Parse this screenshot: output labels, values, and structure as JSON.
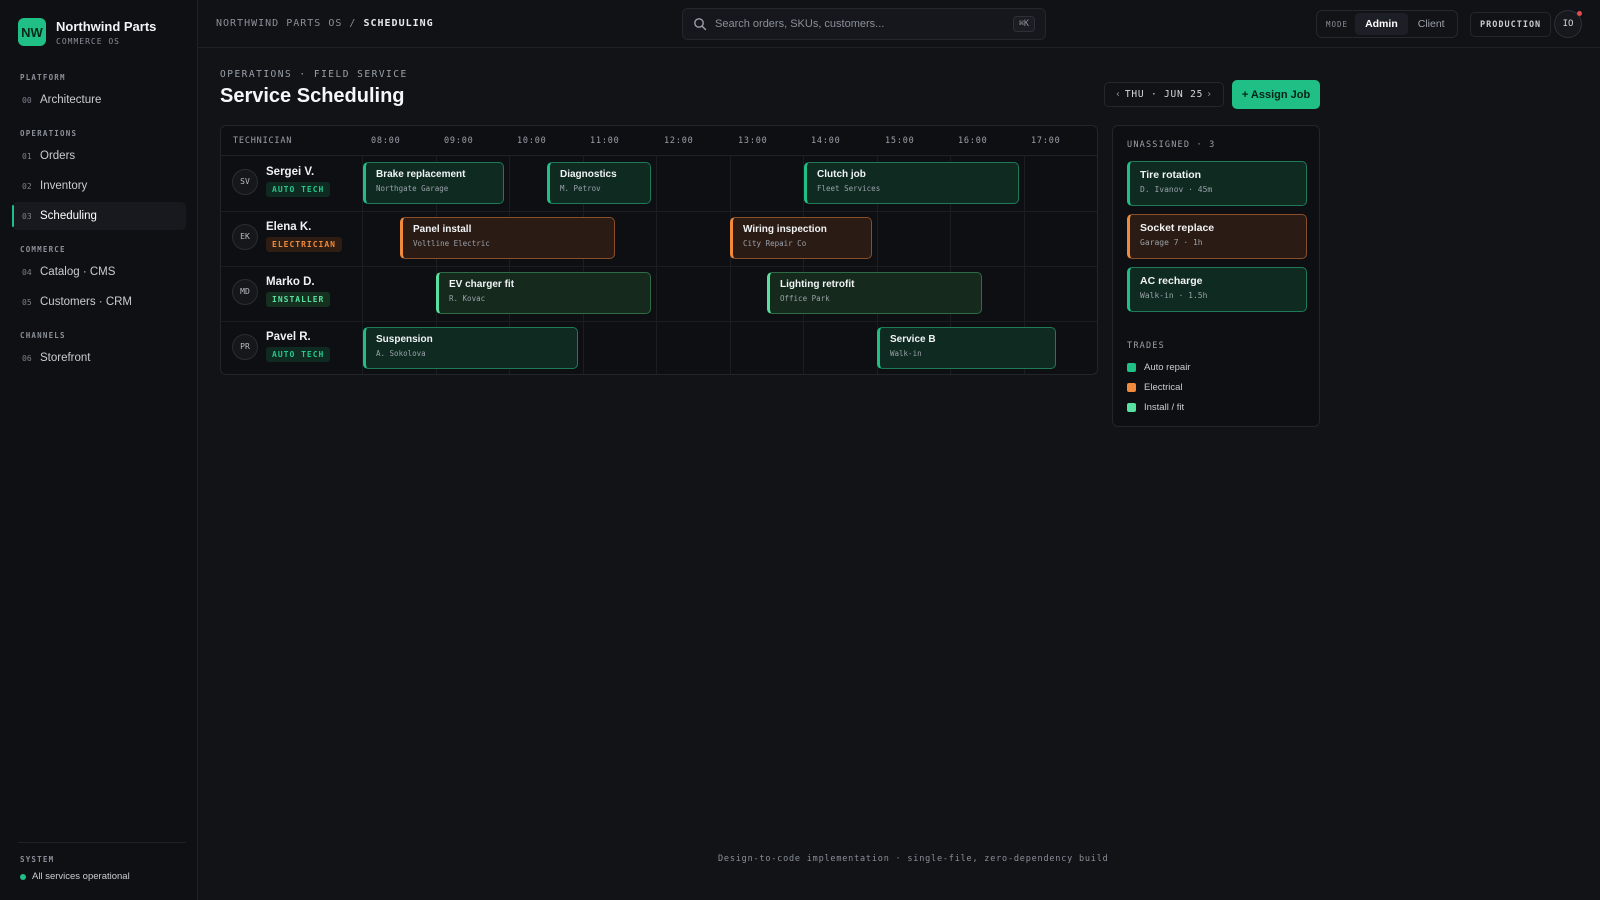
{
  "brand": {
    "logo": "NW",
    "name": "Northwind Parts",
    "subtitle": "COMMERCE OS"
  },
  "sidebar": {
    "sections": [
      {
        "label": "PLATFORM",
        "items": [
          {
            "num": "00",
            "label": "Architecture"
          }
        ]
      },
      {
        "label": "OPERATIONS",
        "items": [
          {
            "num": "01",
            "label": "Orders"
          },
          {
            "num": "02",
            "label": "Inventory"
          },
          {
            "num": "03",
            "label": "Scheduling",
            "active": true
          }
        ]
      },
      {
        "label": "COMMERCE",
        "items": [
          {
            "num": "04",
            "label": "Catalog · CMS"
          },
          {
            "num": "05",
            "label": "Customers · CRM"
          }
        ]
      },
      {
        "label": "CHANNELS",
        "items": [
          {
            "num": "06",
            "label": "Storefront"
          }
        ]
      }
    ],
    "system_label": "SYSTEM",
    "system_status": "All services operational"
  },
  "topbar": {
    "breadcrumb_root": "NORTHWIND PARTS OS",
    "breadcrumb_sep": "/",
    "breadcrumb_current": "SCHEDULING",
    "search_placeholder": "Search orders, SKUs, customers...",
    "search_shortcut": "⌘K",
    "mode_label": "MODE",
    "mode_options": [
      "Admin",
      "Client"
    ],
    "mode_selected": "Admin",
    "environment": "PRODUCTION",
    "user_initials": "IO"
  },
  "header": {
    "eyebrow": "OPERATIONS · FIELD SERVICE",
    "title": "Service Scheduling",
    "date_prev": "‹",
    "date_label": "THU · JUN 25",
    "date_next": "›",
    "assign_button": "+ Assign Job"
  },
  "schedule": {
    "technician_header": "TECHNICIAN",
    "hours": [
      "08:00",
      "09:00",
      "10:00",
      "11:00",
      "12:00",
      "13:00",
      "14:00",
      "15:00",
      "16:00",
      "17:00"
    ],
    "technicians": [
      {
        "initials": "SV",
        "name": "Sergei V.",
        "role": "AUTO TECH",
        "trade": "auto"
      },
      {
        "initials": "EK",
        "name": "Elena K.",
        "role": "ELECTRICIAN",
        "trade": "elec"
      },
      {
        "initials": "MD",
        "name": "Marko D.",
        "role": "INSTALLER",
        "trade": "inst"
      },
      {
        "initials": "PR",
        "name": "Pavel R.",
        "role": "AUTO TECH",
        "trade": "auto"
      }
    ],
    "jobs": [
      {
        "tech": 0,
        "start": "08:00",
        "end": "10:00",
        "title": "Brake replacement",
        "client": "Northgate Garage",
        "trade": "auto"
      },
      {
        "tech": 0,
        "start": "10:30",
        "end": "12:00",
        "title": "Diagnostics",
        "client": "M. Petrov",
        "trade": "auto"
      },
      {
        "tech": 0,
        "start": "14:00",
        "end": "17:00",
        "title": "Clutch job",
        "client": "Fleet Services",
        "trade": "auto"
      },
      {
        "tech": 1,
        "start": "08:30",
        "end": "11:30",
        "title": "Panel install",
        "client": "Voltline Electric",
        "trade": "elec"
      },
      {
        "tech": 1,
        "start": "13:00",
        "end": "15:00",
        "title": "Wiring inspection",
        "client": "City Repair Co",
        "trade": "elec"
      },
      {
        "tech": 2,
        "start": "09:00",
        "end": "12:00",
        "title": "EV charger fit",
        "client": "R. Kovac",
        "trade": "inst"
      },
      {
        "tech": 2,
        "start": "13:30",
        "end": "16:30",
        "title": "Lighting retrofit",
        "client": "Office Park",
        "trade": "inst"
      },
      {
        "tech": 3,
        "start": "08:00",
        "end": "11:00",
        "title": "Suspension",
        "client": "A. Sokolova",
        "trade": "auto"
      },
      {
        "tech": 3,
        "start": "15:00",
        "end": "17:30",
        "title": "Service B",
        "client": "Walk-in",
        "trade": "auto"
      }
    ]
  },
  "unassigned": {
    "title": "UNASSIGNED · 3",
    "items": [
      {
        "title": "Tire rotation",
        "detail": "D. Ivanov · 45m",
        "trade": "auto"
      },
      {
        "title": "Socket replace",
        "detail": "Garage 7 · 1h",
        "trade": "elec"
      },
      {
        "title": "AC recharge",
        "detail": "Walk-in · 1.5h",
        "trade": "auto"
      }
    ]
  },
  "trades": {
    "title": "TRADES",
    "items": [
      {
        "label": "Auto repair",
        "color": "#1fbf85"
      },
      {
        "label": "Electrical",
        "color": "#f08a3c"
      },
      {
        "label": "Install / fit",
        "color": "#59e0a1"
      }
    ]
  },
  "footer_note": "Design-to-code implementation · single-file, zero-dependency build"
}
